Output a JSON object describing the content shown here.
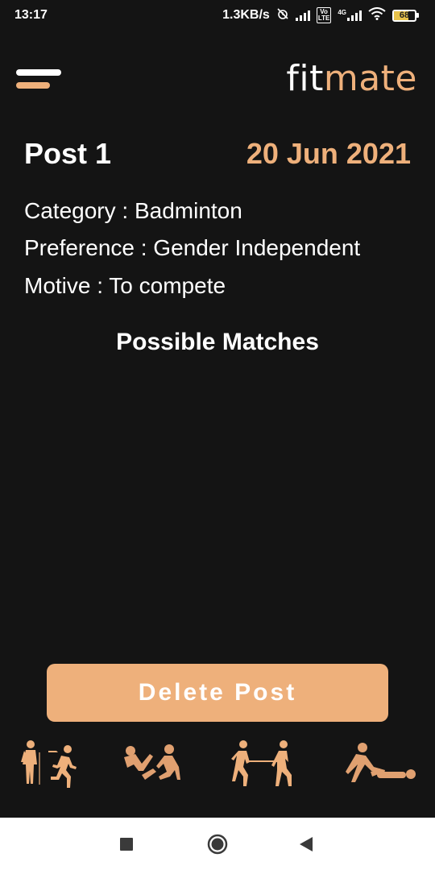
{
  "status_bar": {
    "time": "13:17",
    "net_speed": "1.3KB/s",
    "volte": "Vo\nLTE",
    "net_type": "4G",
    "battery": "68",
    "battery_level": 0.68
  },
  "header": {
    "brand_part1": "fit",
    "brand_part2": "mate",
    "accent_color": "#eeb07b"
  },
  "post": {
    "title": "Post 1",
    "date": "20 Jun 2021",
    "category": "Category : Badminton",
    "preference": "Preference : Gender Independent",
    "motive": "Motive : To compete"
  },
  "matches": {
    "title": "Possible Matches"
  },
  "actions": {
    "delete_label": "Delete Post"
  },
  "footer_icons": [
    "sprint-race-icon",
    "sit-up-partner-icon",
    "tug-of-war-icon",
    "stretching-partner-icon"
  ],
  "nav": [
    "recents-square-icon",
    "home-circle-icon",
    "back-triangle-icon"
  ]
}
